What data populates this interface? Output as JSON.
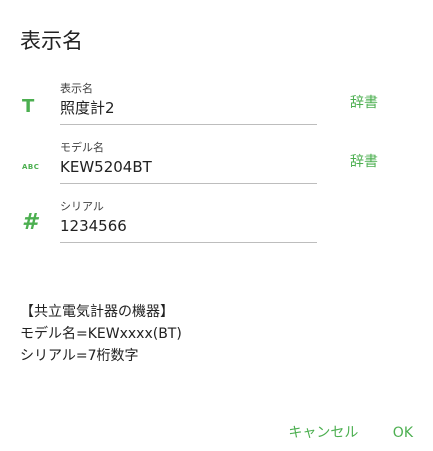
{
  "dialog": {
    "title": "表示名"
  },
  "fields": [
    {
      "icon": "text-format-icon",
      "icon_glyph": "T",
      "label": "表示名",
      "value": "照度計2",
      "button_label": "辞書"
    },
    {
      "icon": "abc-keyboard-icon",
      "icon_glyph": "ABC",
      "label": "モデル名",
      "value": "KEW5204BT",
      "button_label": "辞書"
    },
    {
      "icon": "hash-icon",
      "icon_glyph": "#",
      "label": "シリアル",
      "value": "1234566"
    }
  ],
  "info": {
    "line1": "【共立電気計器の機器】",
    "line2": "モデル名=KEWxxxx(BT)",
    "line3": "シリアル=7桁数字"
  },
  "actions": {
    "cancel_label": "キャンセル",
    "ok_label": "OK"
  },
  "colors": {
    "accent": "#4caf50",
    "text": "#212121",
    "underline": "#bdbdbd"
  }
}
